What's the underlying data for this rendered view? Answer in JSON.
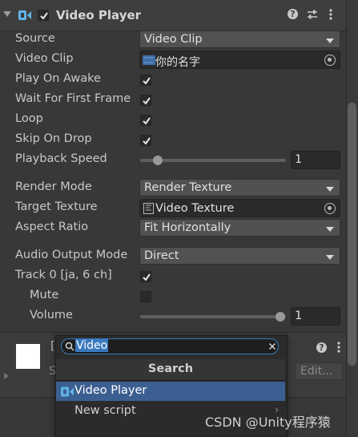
{
  "component": {
    "title": "Video Player",
    "enabled": true,
    "help_icon": "help-icon",
    "preset_icon": "preset-icon",
    "menu_icon": "kebab-menu-icon"
  },
  "fields": {
    "source": {
      "label": "Source",
      "value": "Video Clip"
    },
    "video_clip": {
      "label": "Video Clip",
      "value": "你的名字"
    },
    "play_on_awake": {
      "label": "Play On Awake",
      "checked": true
    },
    "wait_first_frame": {
      "label": "Wait For First Frame",
      "checked": true
    },
    "loop": {
      "label": "Loop",
      "checked": true
    },
    "skip_on_drop": {
      "label": "Skip On Drop",
      "checked": true
    },
    "playback_speed": {
      "label": "Playback Speed",
      "value": "1",
      "level": 0.1
    },
    "render_mode": {
      "label": "Render Mode",
      "value": "Render Texture"
    },
    "target_texture": {
      "label": "Target Texture",
      "value": "Video Texture"
    },
    "aspect_ratio": {
      "label": "Aspect Ratio",
      "value": "Fit Horizontally"
    },
    "audio_output_mode": {
      "label": "Audio Output Mode",
      "value": "Direct"
    },
    "track0": {
      "label": "Track 0 [ja, 6 ch]",
      "checked": true
    },
    "mute": {
      "label": "Mute",
      "checked": false
    },
    "volume": {
      "label": "Volume",
      "value": "1",
      "level": 1.0
    }
  },
  "behind": {
    "label_fragment": "[",
    "s_fragment": "S",
    "edit_label": "Edit..."
  },
  "popup": {
    "search_value": "Video",
    "header": "Search",
    "items": [
      {
        "label": "Video Player",
        "selected": true
      },
      {
        "label": "New script",
        "selected": false
      }
    ]
  },
  "watermark": "CSDN @Unity程序猿",
  "colors": {
    "selected": "#3c5f91",
    "search_border": "#3a79bf",
    "component_icon": "#5fb6e6"
  }
}
